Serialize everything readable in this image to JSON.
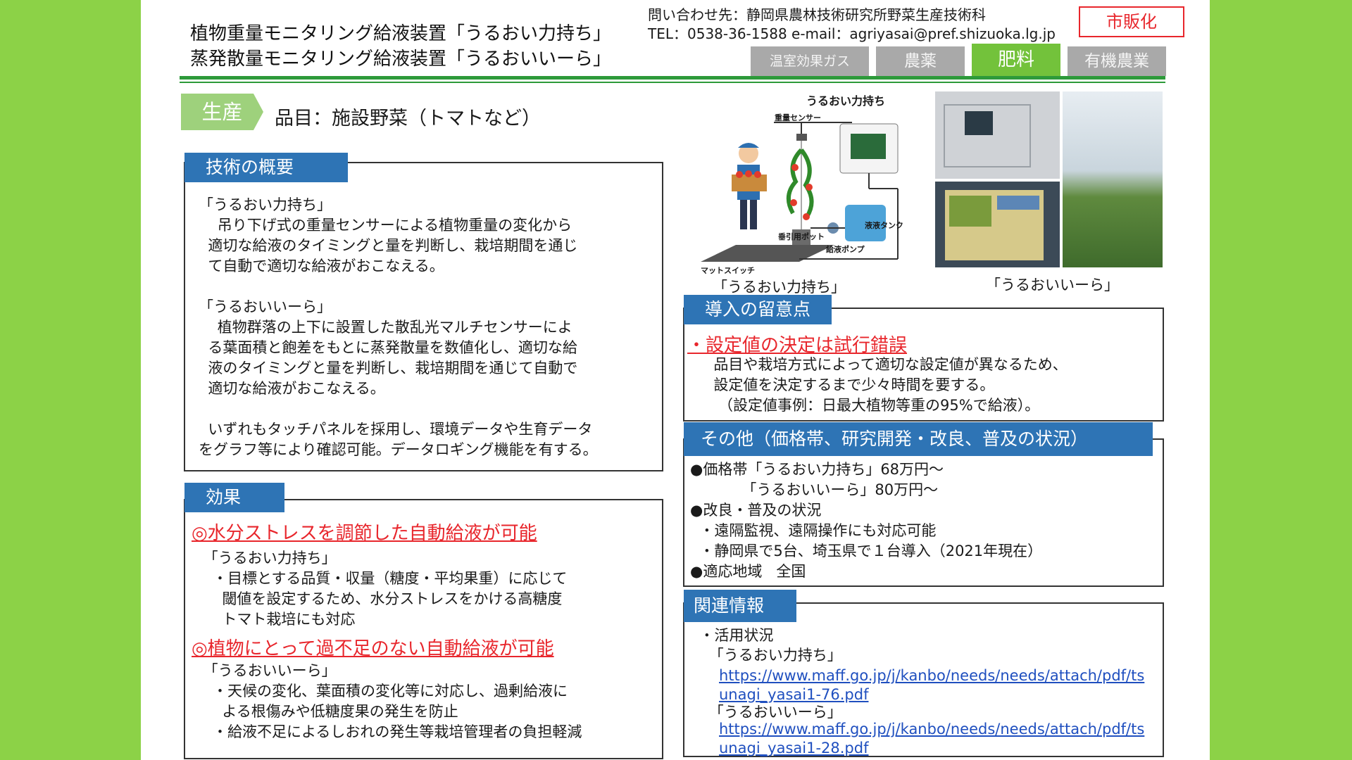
{
  "header": {
    "title_line1": "植物重量モニタリング給液装置「うるおい力持ち」",
    "title_line2": "蒸発散量モニタリング給液装置「うるおいいーら」",
    "contact_line1": "問い合わせ先：静岡県農林技術研究所野菜生産技術科",
    "contact_line2": "TEL：0538-36-1588 e-mail：agriyasai@pref.shizuoka.lg.jp",
    "badge": "市販化",
    "tabs": [
      "温室効果ガス",
      "農薬",
      "肥料",
      "有機農業"
    ],
    "active_tab": "肥料"
  },
  "category": {
    "tag": "生産",
    "item": "品目：施設野菜（トマトなど）"
  },
  "overview": {
    "label": "技術の概要",
    "text": "「うるおい力持ち」\n    吊り下げ式の重量センサーによる植物重量の変化から\n  適切な給液のタイミングと量を判断し、栽培期間を通じ\n  て自動で適切な給液がおこなえる。\n\n「うるおいいーら」\n    植物群落の上下に設置した散乱光マルチセンサーによ\n  る葉面積と飽差をもとに蒸発散量を数値化し、適切な給\n  液のタイミングと量を判断し、栽培期間を通じて自動で\n  適切な給液がおこなえる。\n\n  いずれもタッチパネルを採用し、環境データや生育データ\nをグラフ等により確認可能。データロギング機能を有する。"
  },
  "effects": {
    "label": "効果",
    "heading1": "◎水分ストレスを調節した自動給液が可能",
    "text1": " 「うるおい力持ち」\n   ・目標とする品質・収量（糖度・平均果重）に応じて\n     閾値を設定するため、水分ストレスをかける高糖度\n     トマト栽培にも対応",
    "heading2": "◎植物にとって過不足のない自動給液が可能",
    "text2": " 「うるおいいーら」\n   ・天候の変化、葉面積の変化等に対応し、過剰給液に\n     よる根傷みや低糖度果の発生を防止\n   ・給液不足によるしおれの発生等栽培管理者の負担軽減"
  },
  "figures": {
    "diagram_title": "うるおい力持ち",
    "labels": {
      "sensor": "重量センサー",
      "pot": "垂引用ポット",
      "tank": "液液タンク",
      "pump": "給液ポンプ",
      "mat": "マットスイッチ"
    },
    "caption_left": "「うるおい力持ち」",
    "caption_right": "「うるおいいーら」"
  },
  "points": {
    "label": "導入の留意点",
    "heading": "・設定値の決定は試行錯誤",
    "text": "     品目や栽培方式によって適切な設定値が異なるため、\n     設定値を決定するまで少々時間を要する。\n      （設定値事例：日最大植物等重の95%で給液）。"
  },
  "other": {
    "label": "その他（価格帯、研究開発・改良、普及の状況）",
    "text": "●価格帯「うるおい力持ち」68万円～\n           「うるおいいーら」80万円～\n●改良・普及の状況\n  ・遠隔監視、遠隔操作にも対応可能\n  ・静岡県で5台、埼玉県で１台導入（2021年現在）\n●適応地域   全国"
  },
  "related": {
    "label": "関連情報",
    "text1": "  ・活用状況\n    「うるおい力持ち」",
    "link1": "https://www.maff.go.jp/j/kanbo/needs/needs/attach/pdf/ts\nunagi_yasai1-76.pdf",
    "text2": "    「うるおいいーら」",
    "link2": "https://www.maff.go.jp/j/kanbo/needs/needs/attach/pdf/ts\nunagi_yasai1-28.pdf"
  },
  "colors": {
    "background_green": "#8cd247",
    "label_blue": "#2e74b5",
    "accent_red": "#e8262c",
    "active_tab_green": "#73c23b"
  }
}
